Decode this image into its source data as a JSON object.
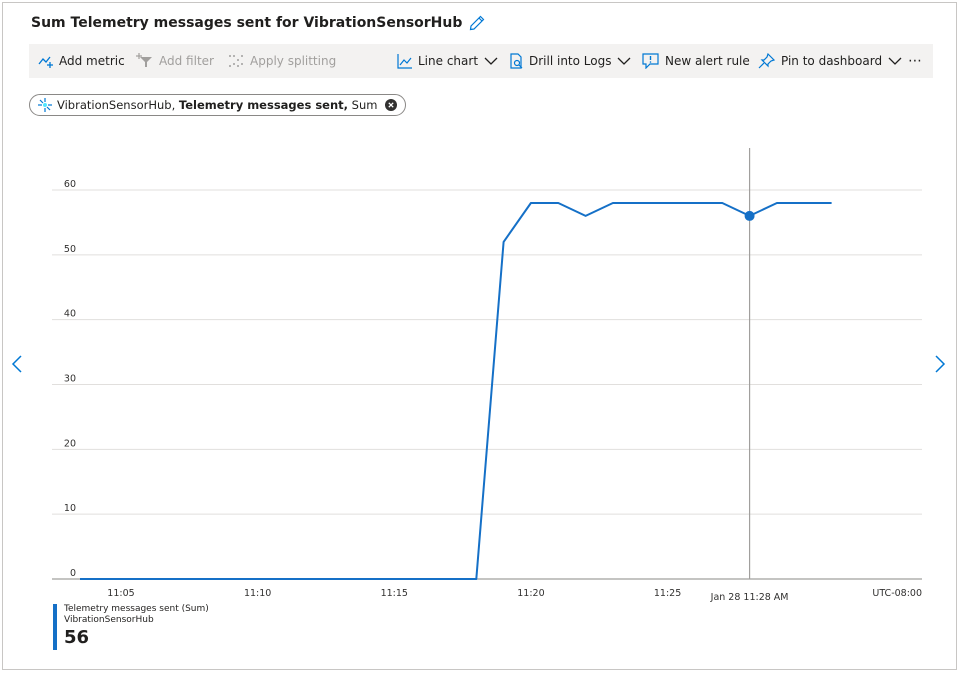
{
  "header": {
    "title": "Sum Telemetry messages sent for VibrationSensorHub"
  },
  "toolbar": {
    "add_metric": "Add metric",
    "add_filter": "Add filter",
    "apply_splitting": "Apply splitting",
    "line_chart": "Line chart",
    "drill_logs": "Drill into Logs",
    "new_alert": "New alert rule",
    "pin_dashboard": "Pin to dashboard",
    "more": "⋯"
  },
  "metric_pill": {
    "resource": "VibrationSensorHub,",
    "metric": "Telemetry messages sent,",
    "aggregation": "Sum"
  },
  "colors": {
    "series": "#1570c7",
    "grid": "#e1dfdd",
    "cursor": "#a19f9d"
  },
  "chart_data": {
    "type": "line",
    "ylim": [
      0,
      60
    ],
    "yticks": [
      "0",
      "10",
      "20",
      "30",
      "40",
      "50",
      "60"
    ],
    "xticks": [
      {
        "label": "11:05",
        "t": 5
      },
      {
        "label": "11:10",
        "t": 10
      },
      {
        "label": "11:15",
        "t": 15
      },
      {
        "label": "11:20",
        "t": 20
      },
      {
        "label": "11:25",
        "t": 25
      }
    ],
    "xlim": [
      3.5,
      28.4
    ],
    "hover": {
      "label": "Jan 28 11:28 AM",
      "t": 28,
      "value": 56
    },
    "timezone": "UTC-08:00",
    "series": [
      {
        "name": "Telemetry messages sent (Sum)",
        "points": [
          [
            3.5,
            0
          ],
          [
            4,
            0
          ],
          [
            5,
            0
          ],
          [
            6,
            0
          ],
          [
            7,
            0
          ],
          [
            8,
            0
          ],
          [
            9,
            0
          ],
          [
            10,
            0
          ],
          [
            11,
            0
          ],
          [
            12,
            0
          ],
          [
            13,
            0
          ],
          [
            14,
            0
          ],
          [
            15,
            0
          ],
          [
            16,
            0
          ],
          [
            17,
            0
          ],
          [
            18,
            0
          ],
          [
            19,
            52
          ],
          [
            20,
            58
          ],
          [
            21,
            58
          ],
          [
            22,
            56
          ],
          [
            23,
            58
          ],
          [
            24,
            58
          ],
          [
            25,
            58
          ],
          [
            26,
            58
          ],
          [
            27,
            58
          ],
          [
            28,
            56
          ],
          [
            29,
            58
          ],
          [
            30,
            58
          ],
          [
            31,
            58
          ]
        ]
      }
    ]
  },
  "legend": {
    "series_name": "Telemetry messages sent (Sum)",
    "resource": "VibrationSensorHub",
    "value": "56"
  }
}
